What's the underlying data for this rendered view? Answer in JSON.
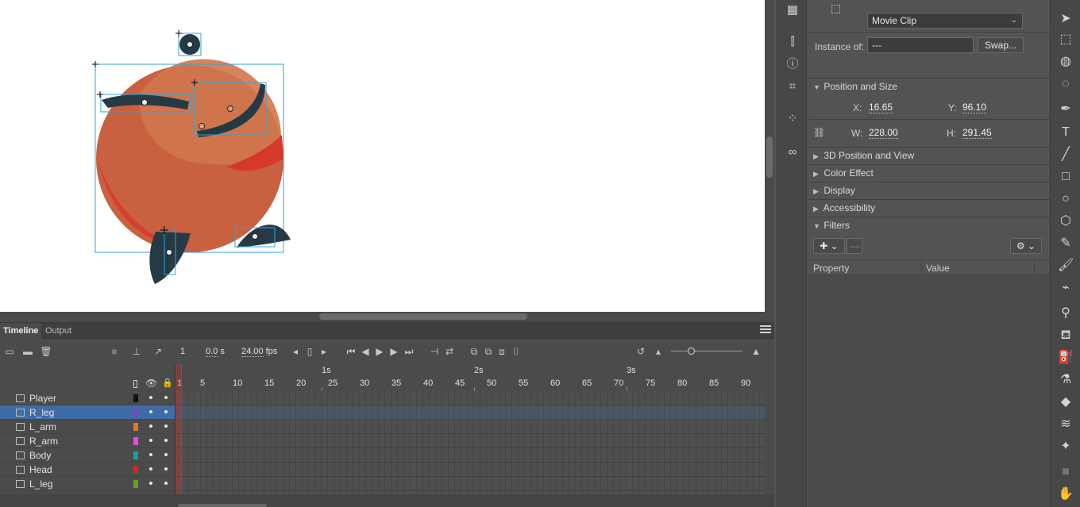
{
  "timeline": {
    "tabs": [
      {
        "label": "Timeline"
      },
      {
        "label": "Output"
      }
    ],
    "current_frame": "1",
    "time": "0.0",
    "time_unit": "s",
    "fps": "24.00",
    "fps_unit": "fps",
    "seconds_marks": [
      "1s",
      "2s",
      "3s"
    ],
    "frame_numbers": [
      "1",
      "5",
      "10",
      "15",
      "20",
      "25",
      "30",
      "35",
      "40",
      "45",
      "50",
      "55",
      "60",
      "65",
      "70",
      "75",
      "80",
      "85",
      "90"
    ],
    "layers": [
      {
        "name": "Player",
        "color": "#111111"
      },
      {
        "name": "R_leg",
        "color": "#8a3fbf",
        "selected": true
      },
      {
        "name": "L_arm",
        "color": "#e07a1c"
      },
      {
        "name": "R_arm",
        "color": "#e84de0"
      },
      {
        "name": "Body",
        "color": "#15a0a0"
      },
      {
        "name": "Head",
        "color": "#e02020"
      },
      {
        "name": "L_leg",
        "color": "#6aa01c"
      }
    ]
  },
  "properties": {
    "symbol_type": "Movie Clip",
    "instance_of_label": "Instance of:",
    "instance_of_value": "---",
    "swap_label": "Swap...",
    "position_and_size": "Position and Size",
    "x_label": "X:",
    "x_value": "16.65",
    "y_label": "Y:",
    "y_value": "96.10",
    "w_label": "W:",
    "w_value": "228.00",
    "h_label": "H:",
    "h_value": "291.45",
    "sections": [
      "3D Position and View",
      "Color Effect",
      "Display",
      "Accessibility"
    ],
    "filters_label": "Filters",
    "filter_columns": [
      "Property",
      "Value"
    ]
  },
  "colors": {
    "stage": "#ffffff",
    "selection": "#3e6ca6",
    "body_fill": "#c9603f",
    "limb_fill": "#263a46"
  }
}
